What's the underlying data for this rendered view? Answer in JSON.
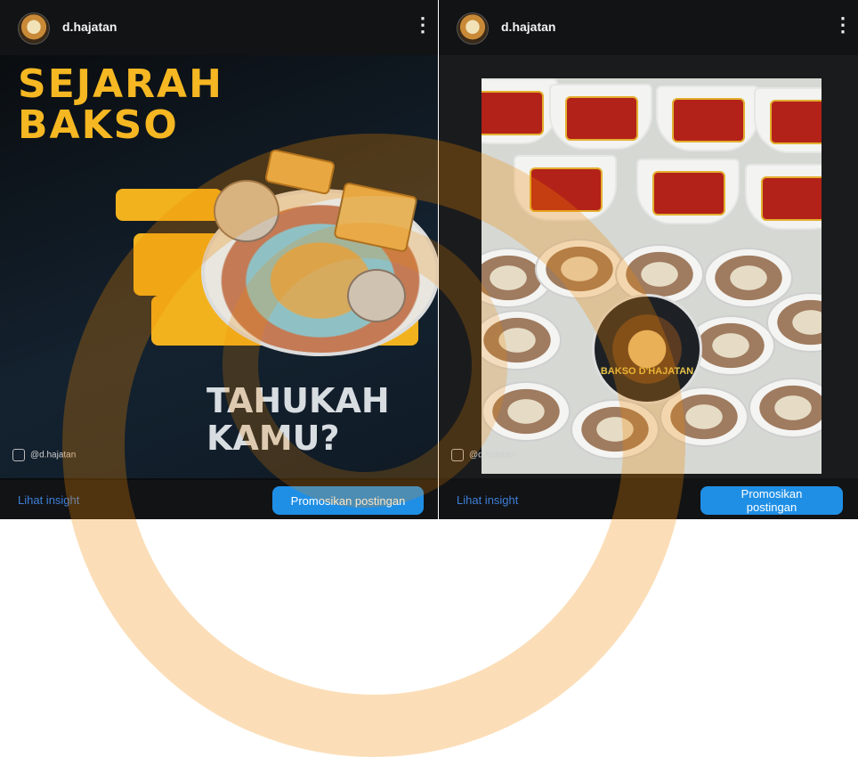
{
  "posts": [
    {
      "username": "d.hajatan",
      "more_icon": "⋮",
      "headline_line1": "SEJARAH",
      "headline_line2": "BAKSO",
      "subheadline_line1": "TAHUKAH",
      "subheadline_line2": "KAMU?",
      "handle": "@d.hajatan",
      "insight_label": "Lihat insight",
      "promote_label": "Promosikan postingan"
    },
    {
      "username": "d.hajatan",
      "more_icon": "⋮",
      "sticker_text": "BAKSO D'HAJATAN",
      "handle": "@d.hajatan",
      "insight_label": "Lihat insight",
      "promote_label": "Promosikan postingan"
    }
  ],
  "colors": {
    "accent_yellow": "#f5b722",
    "button_blue": "#1f8fe6",
    "link_blue": "#3d7fd9",
    "watermark_orange": "#f08a00"
  },
  "icons": [
    "avatar",
    "more-options-icon",
    "instagram-icon"
  ]
}
